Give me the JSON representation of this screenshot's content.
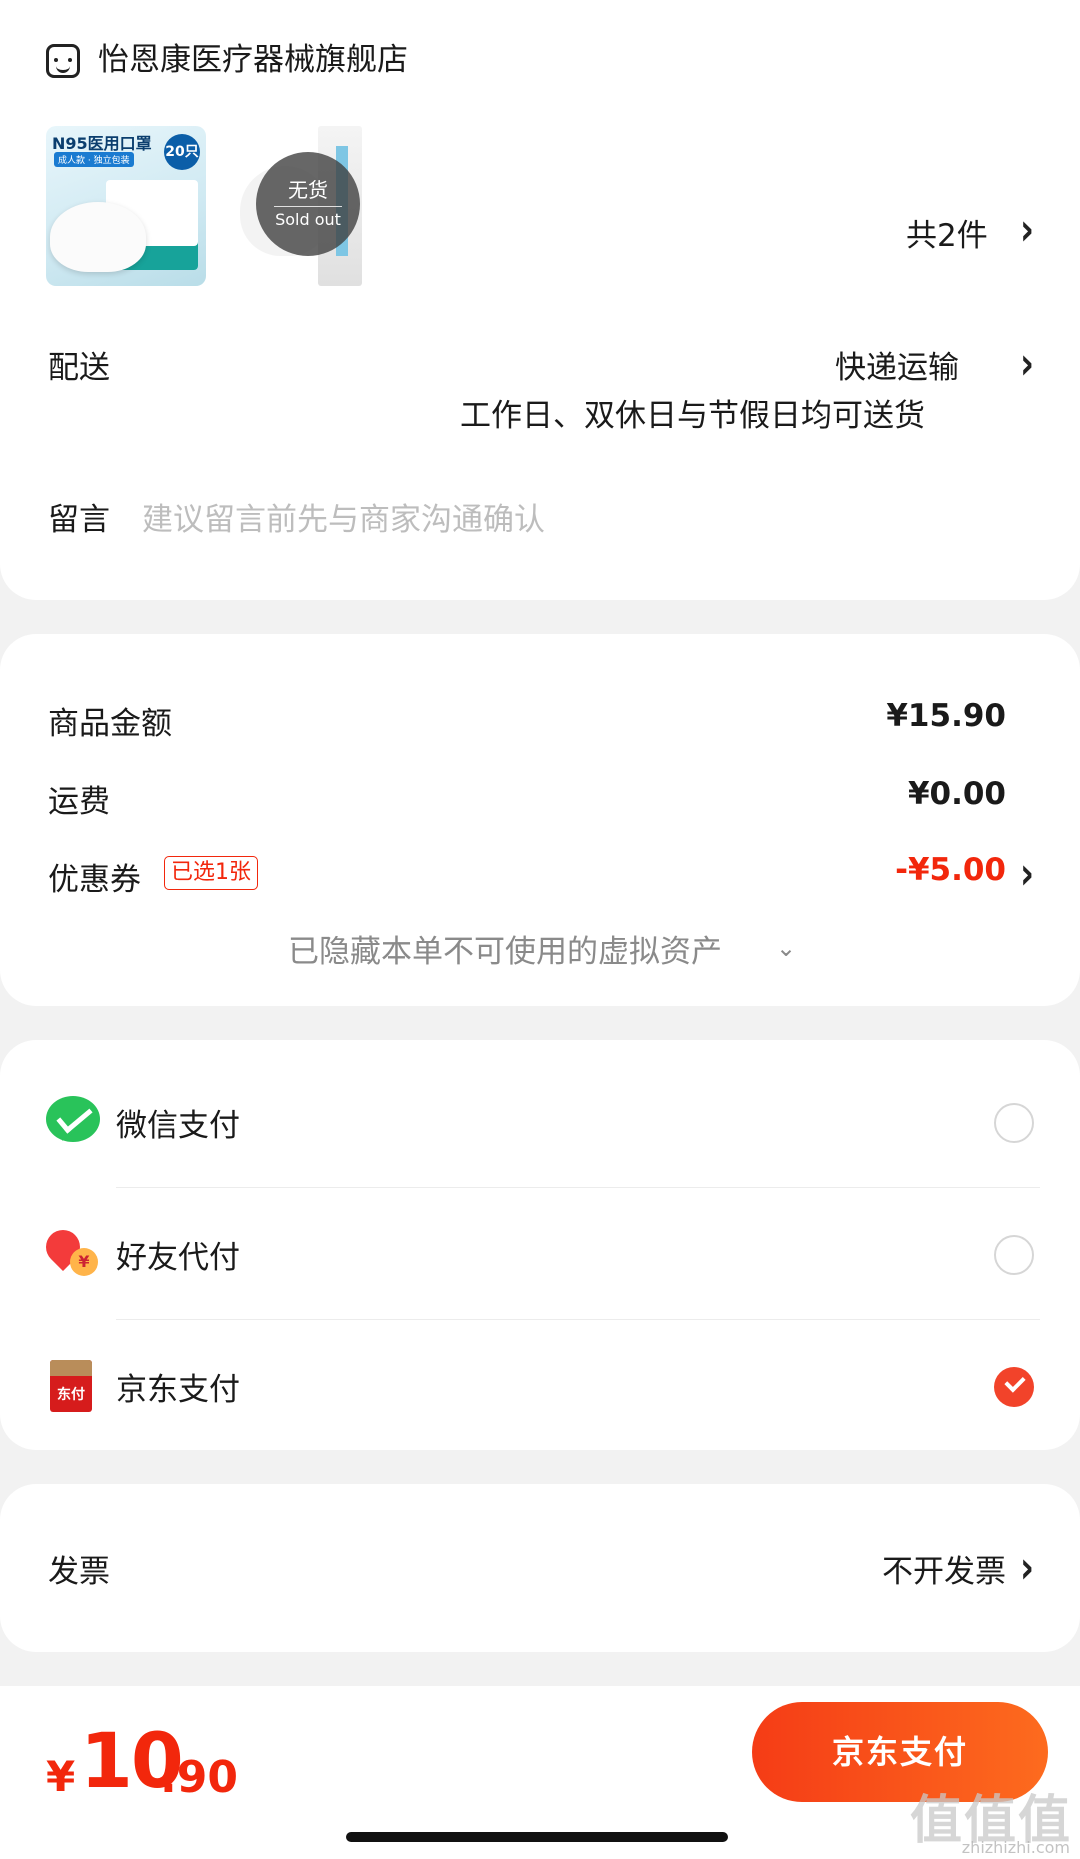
{
  "store": {
    "name": "怡恩康医疗器械旗舰店"
  },
  "products": [
    {
      "title": "N95医用口罩",
      "subtitle": "成人款 · 独立包装",
      "count_badge": "20只"
    },
    {
      "soldout_cn": "无货",
      "soldout_en": "Sold out"
    }
  ],
  "item_count": "共2件",
  "delivery": {
    "label": "配送",
    "method": "快递运输",
    "note": "工作日、双休日与节假日均可送货"
  },
  "message": {
    "label": "留言",
    "placeholder": "建议留言前先与商家沟通确认"
  },
  "price": {
    "goods_label": "商品金额",
    "goods_value": "¥15.90",
    "shipping_label": "运费",
    "shipping_value": "¥0.00",
    "coupon_label": "优惠券",
    "coupon_badge": "已选1张",
    "coupon_value": "-¥5.00",
    "hidden_note": "已隐藏本单不可使用的虚拟资产"
  },
  "payment": {
    "options": [
      {
        "label": "微信支付",
        "selected": false
      },
      {
        "label": "好友代付",
        "selected": false
      },
      {
        "label": "京东支付",
        "selected": true,
        "icon_text": "东付"
      }
    ]
  },
  "invoice": {
    "label": "发票",
    "value": "不开发票"
  },
  "bottom": {
    "yen": "¥",
    "total_int": "10",
    "total_dec": ".90",
    "pay_button": "京东支付",
    "watermark": "值值值",
    "watermark_url": "zhizhizhi.com"
  },
  "colors": {
    "accent": "#f2270c",
    "wechat": "#29c35a"
  }
}
